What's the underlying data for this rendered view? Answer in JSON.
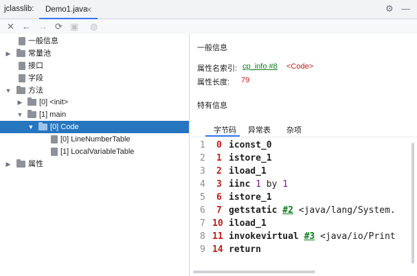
{
  "window": {
    "app_title": "jclasslib:",
    "tab_label": "Demo1.java",
    "tab_close": "✕",
    "settings_icon": "gear-icon",
    "minimize_icon": "minus-icon"
  },
  "toolbar": {
    "close": "✕",
    "back": "←",
    "forward": "→",
    "refresh": "⟳",
    "save": "▣",
    "browser": "◍"
  },
  "tree": {
    "items": [
      {
        "label": "一般信息"
      },
      {
        "label": "常量池"
      },
      {
        "label": "接口"
      },
      {
        "label": "字段"
      },
      {
        "label": "方法"
      },
      {
        "label": "[0] <init>"
      },
      {
        "label": "[1] main"
      },
      {
        "label": "[0] Code"
      },
      {
        "label": "[0] LineNumberTable"
      },
      {
        "label": "[1] LocalVariableTable"
      },
      {
        "label": "属性"
      }
    ]
  },
  "detail": {
    "general_title": "一般信息",
    "attr_name_label": "属性名索引:",
    "attr_name_link": "cp_info #8",
    "attr_name_value": "<Code>",
    "attr_length_label": "属性长度:",
    "attr_length_value": "79",
    "specific_title": "特有信息",
    "tabs": [
      "字节码",
      "异常表",
      "杂项"
    ]
  },
  "code": {
    "lines": [
      {
        "ln": "1",
        "off": "0",
        "instr": "iconst_0"
      },
      {
        "ln": "2",
        "off": "1",
        "instr": "istore_1"
      },
      {
        "ln": "3",
        "off": "2",
        "instr": "iload_1"
      },
      {
        "ln": "4",
        "off": "3",
        "instr": "iinc",
        "a": "1",
        "by": "by",
        "b": "1"
      },
      {
        "ln": "5",
        "off": "6",
        "instr": "istore_1"
      },
      {
        "ln": "6",
        "off": "7",
        "instr": "getstatic",
        "ref": "#2",
        "rest": "<java/lang/System."
      },
      {
        "ln": "7",
        "off": "10",
        "instr": "iload_1"
      },
      {
        "ln": "8",
        "off": "11",
        "instr": "invokevirtual",
        "ref": "#3",
        "rest": "<java/io/Print"
      },
      {
        "ln": "9",
        "off": "14",
        "instr": "return"
      }
    ]
  }
}
